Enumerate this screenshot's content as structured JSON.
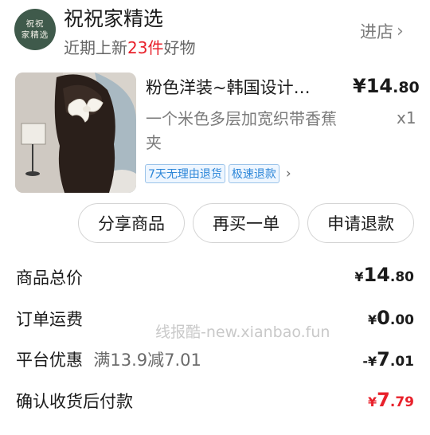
{
  "store": {
    "logo_line1": "祝祝",
    "logo_line2": "家精选",
    "name": "祝祝家精选",
    "sub_prefix": "近期上新",
    "sub_highlight": "23件",
    "sub_suffix": "好物",
    "enter_label": "进店"
  },
  "product": {
    "title": "粉色洋装~韩国设计…",
    "spec": "一个米色多层加宽织带香蕉夹",
    "price_currency": "¥",
    "price_int": "14",
    "price_dec": ".80",
    "qty": "x1",
    "tags": [
      "7天无理由退货",
      "极速退款"
    ]
  },
  "actions": {
    "share": "分享商品",
    "rebuy": "再买一单",
    "refund": "申请退款"
  },
  "summary": {
    "total_label": "商品总价",
    "total_cur": "¥",
    "total_int": "14",
    "total_dec": ".80",
    "shipping_label": "订单运费",
    "shipping_cur": "¥",
    "shipping_int": "0",
    "shipping_dec": ".00",
    "discount_label": "平台优惠",
    "discount_detail": "满13.9减7.01",
    "discount_prefix": "-¥",
    "discount_int": "7",
    "discount_dec": ".01",
    "pay_label": "确认收货后付款",
    "pay_cur": "¥",
    "pay_int": "7",
    "pay_dec": ".79"
  },
  "watermark": "线报酷-new.xianbao.fun",
  "colors": {
    "accent_red": "#e8212b",
    "tag_blue": "#2c86d8",
    "logo_green": "#3f5a4b"
  }
}
